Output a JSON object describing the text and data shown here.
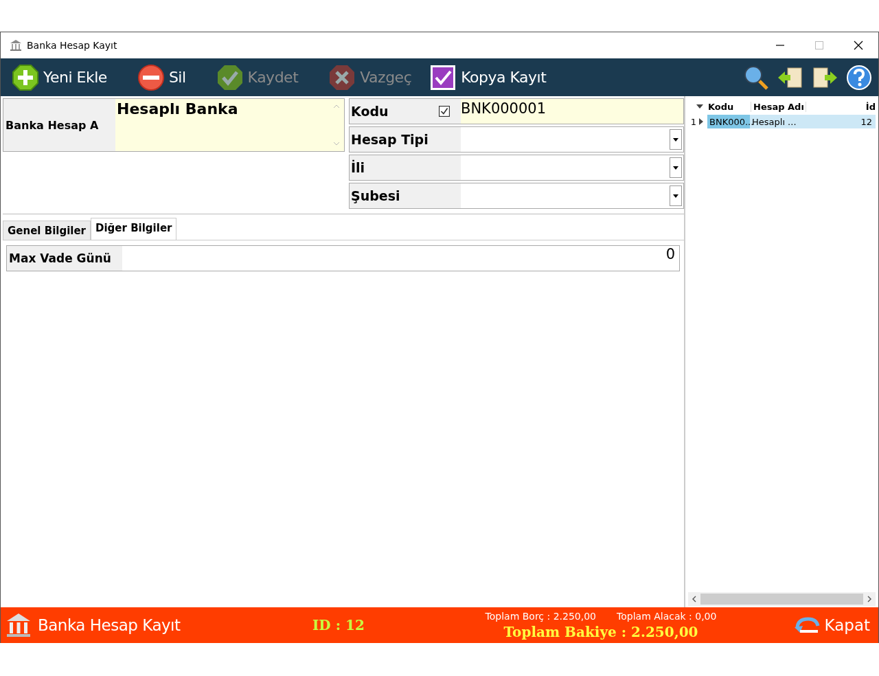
{
  "window": {
    "title": "Banka Hesap Kayıt"
  },
  "toolbar": [
    {
      "label": "Yeni Ekle",
      "kind": "add",
      "disabled": false
    },
    {
      "label": "Sil",
      "kind": "delete",
      "disabled": false
    },
    {
      "label": "Kaydet",
      "kind": "save",
      "disabled": true
    },
    {
      "label": "Vazgeç",
      "kind": "cancel",
      "disabled": true
    },
    {
      "label": "Kopya Kayıt",
      "kind": "copy",
      "disabled": false
    }
  ],
  "form": {
    "name_label": "Banka Hesap A",
    "name_value": "Hesaplı Banka",
    "fields": [
      {
        "label": "Kodu",
        "kind": "text",
        "checked": true,
        "value": "BNK000001"
      },
      {
        "label": "Hesap Tipi",
        "kind": "select"
      },
      {
        "label": "İli",
        "kind": "select"
      },
      {
        "label": "Şubesi",
        "kind": "select"
      }
    ]
  },
  "tabs": [
    {
      "label": "Genel Bilgiler",
      "selected": false
    },
    {
      "label": "Diğer Bilgiler",
      "selected": true
    }
  ],
  "tab_fields": [
    {
      "label": "Max Vade Günü",
      "value": "0"
    }
  ],
  "grid": {
    "columns": [
      "Kodu",
      "Hesap Adı",
      "İd"
    ],
    "rows": [
      {
        "number": "1",
        "cells": [
          "BNK000...",
          "Hesaplı ...",
          "12"
        ],
        "selected": true
      }
    ]
  },
  "footer": {
    "title": "Banka Hesap Kayıt",
    "id": "ID : 12",
    "borc": "Toplam Borç : 2.250,00",
    "alacak": "Toplam Alacak : 0,00",
    "bakiye": "Toplam Bakiye : 2.250,00",
    "close": "Kapat"
  }
}
